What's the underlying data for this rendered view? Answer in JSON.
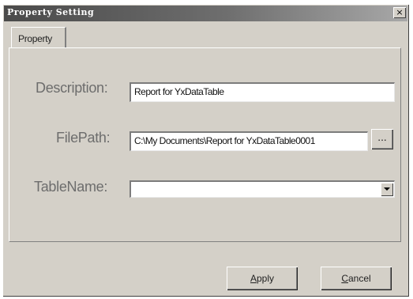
{
  "window": {
    "title": "Property Setting",
    "close_glyph": "×"
  },
  "tabs": [
    {
      "label": "Property"
    }
  ],
  "form": {
    "description": {
      "label": "Description:",
      "value": "Report for YxDataTable"
    },
    "filepath": {
      "label": "FilePath:",
      "value": "C:\\My Documents\\Report for YxDataTable0001",
      "browse_label": "..."
    },
    "tablename": {
      "label": "TableName:",
      "value": ""
    }
  },
  "buttons": {
    "apply": {
      "mnemonic": "A",
      "rest": "pply"
    },
    "cancel": {
      "mnemonic": "C",
      "rest": "ancel"
    }
  },
  "icons": {
    "close": "close-icon",
    "dropdown": "chevron-down-icon"
  },
  "colors": {
    "titlebar_dark": "#4a4a4a",
    "face": "#d4d0c8",
    "label_text": "#6d6d6d"
  }
}
